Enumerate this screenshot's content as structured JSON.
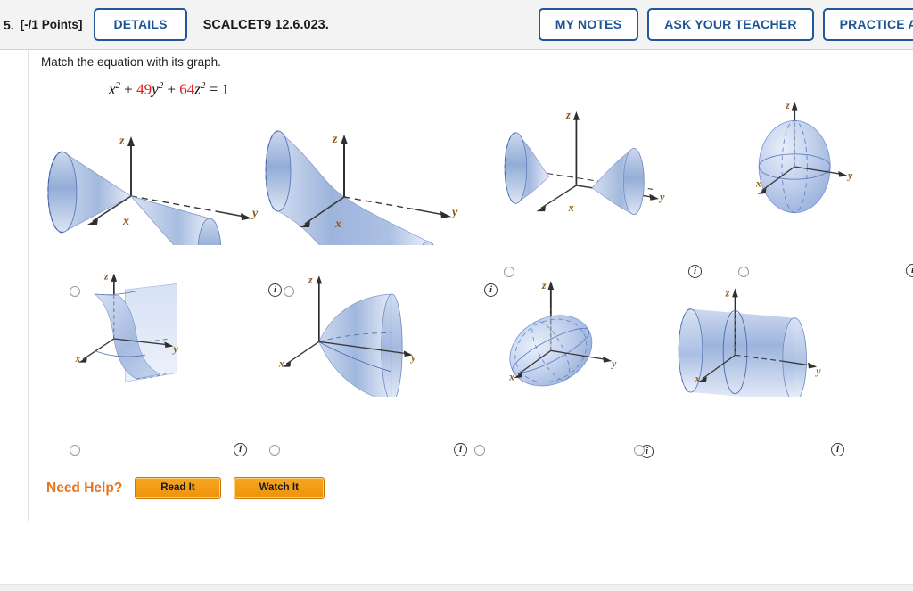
{
  "header": {
    "question_number": "5.",
    "points": "[-/1 Points]",
    "details_label": "DETAILS",
    "question_code": "SCALCET9 12.6.023.",
    "my_notes_label": "MY NOTES",
    "ask_teacher_label": "ASK YOUR TEACHER",
    "practice_label": "PRACTICE ANOTHER"
  },
  "question": {
    "prompt": "Match the equation with its graph.",
    "equation": {
      "term1_var": "x",
      "term1_exp": "2",
      "plus1": "+",
      "coef2": "49",
      "term2_var": "y",
      "term2_exp": "2",
      "plus2": "+",
      "coef3": "64",
      "term3_var": "z",
      "term3_exp": "2",
      "equals": "=",
      "rhs": "1"
    },
    "equation_plain": "x2 + 49y2 + 64z2 = 1"
  },
  "options": [
    {
      "id": "a",
      "surface": "double-cone-along-y",
      "axis_x": "x",
      "axis_y": "y",
      "axis_z": "z",
      "info_label": "i"
    },
    {
      "id": "b",
      "surface": "hyperboloid-one-sheet-y",
      "axis_x": "x",
      "axis_y": "y",
      "axis_z": "z",
      "info_label": "i"
    },
    {
      "id": "c",
      "surface": "hyperboloid-two-sheets-y",
      "axis_x": "x",
      "axis_y": "y",
      "axis_z": "z",
      "info_label": "i"
    },
    {
      "id": "d",
      "surface": "ellipsoid-tall-z",
      "axis_x": "x",
      "axis_y": "y",
      "axis_z": "z",
      "info_label": "i"
    },
    {
      "id": "e",
      "surface": "hyperbolic-paraboloid",
      "axis_x": "x",
      "axis_y": "y",
      "axis_z": "z",
      "info_label": "i"
    },
    {
      "id": "f",
      "surface": "elliptic-paraboloid-along-y",
      "axis_x": "x",
      "axis_y": "y",
      "axis_z": "z",
      "info_label": "i"
    },
    {
      "id": "g",
      "surface": "ellipsoid-flat-tilted",
      "axis_x": "x",
      "axis_y": "y",
      "axis_z": "z",
      "info_label": "i"
    },
    {
      "id": "h",
      "surface": "circular-cylinder-along-y",
      "axis_x": "x",
      "axis_y": "y",
      "axis_z": "z",
      "info_label": "i"
    }
  ],
  "help": {
    "label": "Need Help?",
    "read_label": "Read It",
    "watch_label": "Watch It"
  },
  "colors": {
    "brand_blue": "#1c5596",
    "header_bg": "#f3f3f3",
    "red_coefficient": "#e01b1b",
    "help_orange": "#e8741b",
    "button_orange": "#f5a623",
    "axis_label": "#8a5a14",
    "surface_blue": "#a8bde0"
  }
}
